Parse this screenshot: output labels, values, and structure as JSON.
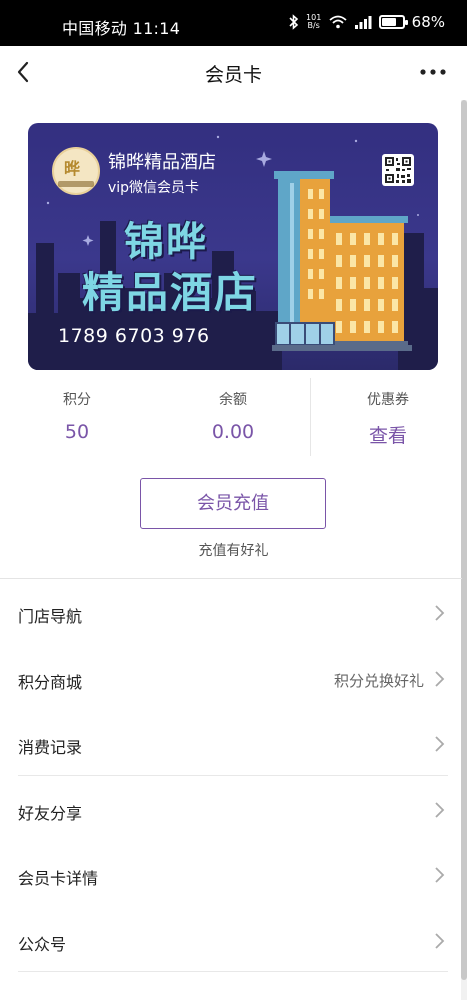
{
  "status_bar": {
    "carrier_time": "中国移动 11:14",
    "net_speed_top": "101",
    "net_speed_bottom": "B/s",
    "battery_text": "68%",
    "battery_level": 0.68
  },
  "nav": {
    "title": "会员卡",
    "back_icon": "chevron-left-icon",
    "more_icon": "more-dots-icon"
  },
  "card": {
    "hotel_name": "锦晔精品酒店",
    "subtitle": "vip微信会员卡",
    "headline_line1": "锦晔",
    "headline_line2": "精品酒店",
    "card_number": "1789 6703 976",
    "logo_mark": "晔",
    "qr_icon": "qr-code-icon",
    "colors": {
      "background": "#332f80",
      "headline": "#7ed6e4",
      "building_orange": "#e8a23c",
      "building_teal": "#5fa6c8"
    }
  },
  "stats": [
    {
      "label": "积分",
      "value": "50"
    },
    {
      "label": "余额",
      "value": "0.00"
    },
    {
      "label": "优惠券",
      "value": "查看"
    }
  ],
  "recharge": {
    "button_label": "会员充值",
    "hint": "充值有好礼"
  },
  "menu": [
    {
      "label": "门店导航",
      "extra": ""
    },
    {
      "label": "积分商城",
      "extra": "积分兑换好礼"
    },
    {
      "label": "消费记录",
      "extra": ""
    },
    {
      "label": "好友分享",
      "extra": ""
    },
    {
      "label": "会员卡详情",
      "extra": ""
    },
    {
      "label": "公众号",
      "extra": ""
    }
  ],
  "colors": {
    "accent": "#7a55a8",
    "status_bar": "#000000"
  }
}
